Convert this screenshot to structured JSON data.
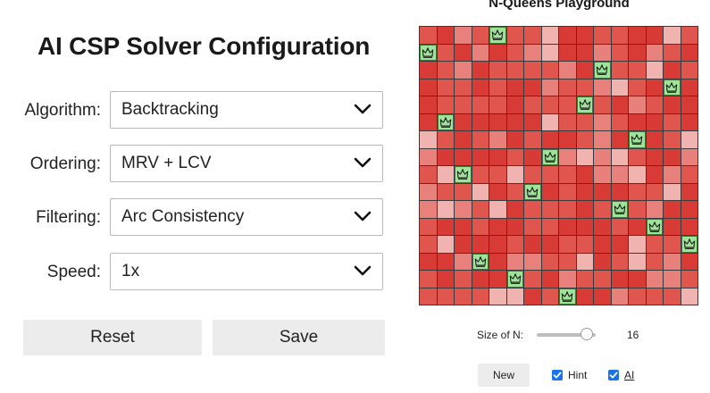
{
  "config": {
    "title": "AI CSP Solver Configuration",
    "fields": [
      {
        "label": "Algorithm:",
        "value": "Backtracking"
      },
      {
        "label": "Ordering:",
        "value": "MRV + LCV"
      },
      {
        "label": "Filtering:",
        "value": "Arc Consistency"
      },
      {
        "label": "Speed:",
        "value": "1x"
      }
    ],
    "reset_label": "Reset",
    "save_label": "Save"
  },
  "playground": {
    "title": "N-Queens Playground",
    "size_label": "Size of N:",
    "size_value": "16",
    "size_fraction": 0.85,
    "new_label": "New",
    "hint_label": "Hint",
    "hint_checked": true,
    "ai_label": "AI",
    "ai_checked": true,
    "n": 16,
    "queen_columns_by_row": [
      4,
      0,
      10,
      14,
      9,
      1,
      12,
      7,
      2,
      6,
      11,
      13,
      15,
      3,
      5,
      8
    ],
    "colors": {
      "queen_cell": "#9fe39a",
      "conflict_red": "#d83a36",
      "grid_line": "#3a3a3a",
      "checkbox": "#1a73e8"
    }
  }
}
